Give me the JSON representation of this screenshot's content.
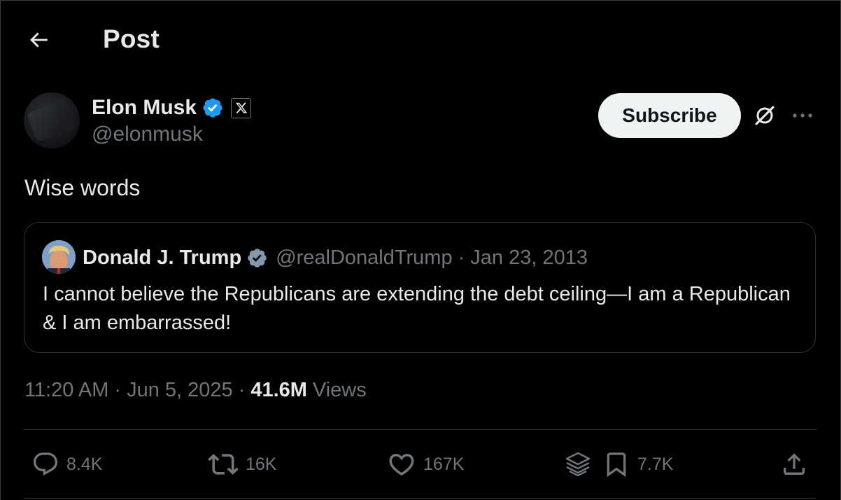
{
  "header": {
    "title": "Post",
    "back_icon": "back-arrow-icon"
  },
  "author": {
    "name": "Elon Musk",
    "handle": "@elonmusk",
    "verified_color": "#1d9bf0",
    "affiliate_badge_icon": "x-logo-icon"
  },
  "actions_top": {
    "subscribe_label": "Subscribe",
    "grok_icon": "grok-icon",
    "more_icon": "more-horizontal-icon"
  },
  "post": {
    "text": "Wise words"
  },
  "quote": {
    "name": "Donald J. Trump",
    "handle": "@realDonaldTrump",
    "separator": "·",
    "date": "Jan 23, 2013",
    "text": "I cannot believe the Republicans are extending the debt ceiling—I am a Republican & I am embarrassed!"
  },
  "meta": {
    "time": "11:20 AM",
    "separator": "·",
    "date": "Jun 5, 2025",
    "views_count": "41.6M",
    "views_label": "Views"
  },
  "engagement": {
    "replies": "8.4K",
    "reposts": "16K",
    "likes": "167K",
    "bookmarks": "7.7K",
    "reply_icon": "reply-icon",
    "repost_icon": "repost-icon",
    "like_icon": "heart-icon",
    "grok_stack_icon": "grok-layers-icon",
    "bookmark_icon": "bookmark-icon",
    "share_icon": "share-icon"
  },
  "colors": {
    "background": "#000000",
    "text_primary": "#e7e9ea",
    "text_secondary": "#71767b",
    "border": "#2f3336",
    "button_bg": "#eff3f4",
    "verified": "#1d9bf0"
  }
}
